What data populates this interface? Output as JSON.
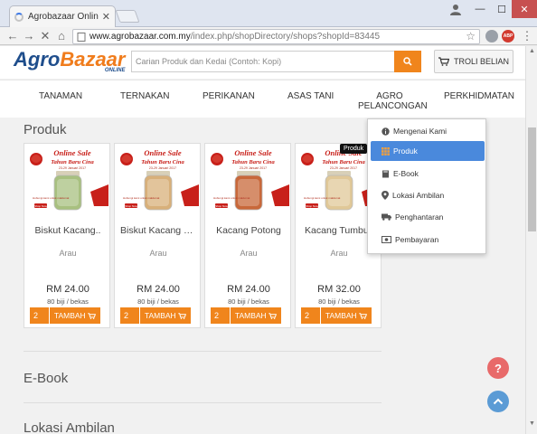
{
  "browser": {
    "tab_title": "Agrobazaar Online: g sh",
    "url_host": "www.agrobazaar.com.my",
    "url_path": "/index.php/shopDirectory/shops?shopId=83445",
    "ext_badge": "ABP"
  },
  "site": {
    "logo_part1": "Agro",
    "logo_part2": "Bazaar",
    "logo_sub": "ONLINE",
    "search_placeholder": "Carian Produk dan Kedai (Contoh: Kopi)",
    "cart_label": "TROLI BELIAN"
  },
  "menu": {
    "items": [
      {
        "label": "TANAMAN"
      },
      {
        "label": "TERNAKAN"
      },
      {
        "label": "PERIKANAN"
      },
      {
        "label": "ASAS TANI"
      },
      {
        "label": "AGRO PELANCONGAN"
      },
      {
        "label": "PERKHIDMATAN"
      }
    ]
  },
  "sections": {
    "produk": "Produk",
    "ebook": "E-Book",
    "lokasi_partial": "Lokasi Ambilan"
  },
  "product_banner": {
    "line1": "Online Sale",
    "line2": "Tahun Baru Cina",
    "line3": "23-29 Januari 2017",
    "shop_now": "Shop Now",
    "fine_print": "Hubungi kami untuk maklumat"
  },
  "products": [
    {
      "name": "Biskut Kacang..",
      "loc": "Arau",
      "price": "RM 24.00",
      "unit": "80 biji / bekas",
      "qty": "2",
      "add": "TAMBAH",
      "jar_color": "#a8c080"
    },
    {
      "name": "Biskut Kacang @..",
      "loc": "Arau",
      "price": "RM 24.00",
      "unit": "80 biji / bekas",
      "qty": "2",
      "add": "TAMBAH",
      "jar_color": "#d8b07a"
    },
    {
      "name": "Kacang Potong",
      "loc": "Arau",
      "price": "RM 24.00",
      "unit": "80 biji / bekas",
      "qty": "2",
      "add": "TAMBAH",
      "jar_color": "#c8683a"
    },
    {
      "name": "Kacang Tumbuk",
      "loc": "Arau",
      "price": "RM 32.00",
      "unit": "80 biji / bekas",
      "qty": "2",
      "add": "TAMBAH",
      "jar_color": "#e0c898"
    }
  ],
  "dropdown": {
    "tooltip": "Produk",
    "items": [
      {
        "label": "Mengenai Kami",
        "icon": "info-icon"
      },
      {
        "label": "Produk",
        "icon": "grid-icon"
      },
      {
        "label": "E-Book",
        "icon": "book-icon"
      },
      {
        "label": "Lokasi Ambilan",
        "icon": "map-marker-icon"
      },
      {
        "label": "Penghantaran",
        "icon": "truck-icon"
      },
      {
        "label": "Pembayaran",
        "icon": "money-icon"
      }
    ]
  },
  "colors": {
    "brand_blue": "#1f4e8c",
    "brand_orange": "#f07c1c",
    "active_blue": "#4a89dc",
    "help_red": "#e86a6a",
    "top_blue": "#5b9bd5"
  },
  "fab": {
    "help": "?"
  }
}
